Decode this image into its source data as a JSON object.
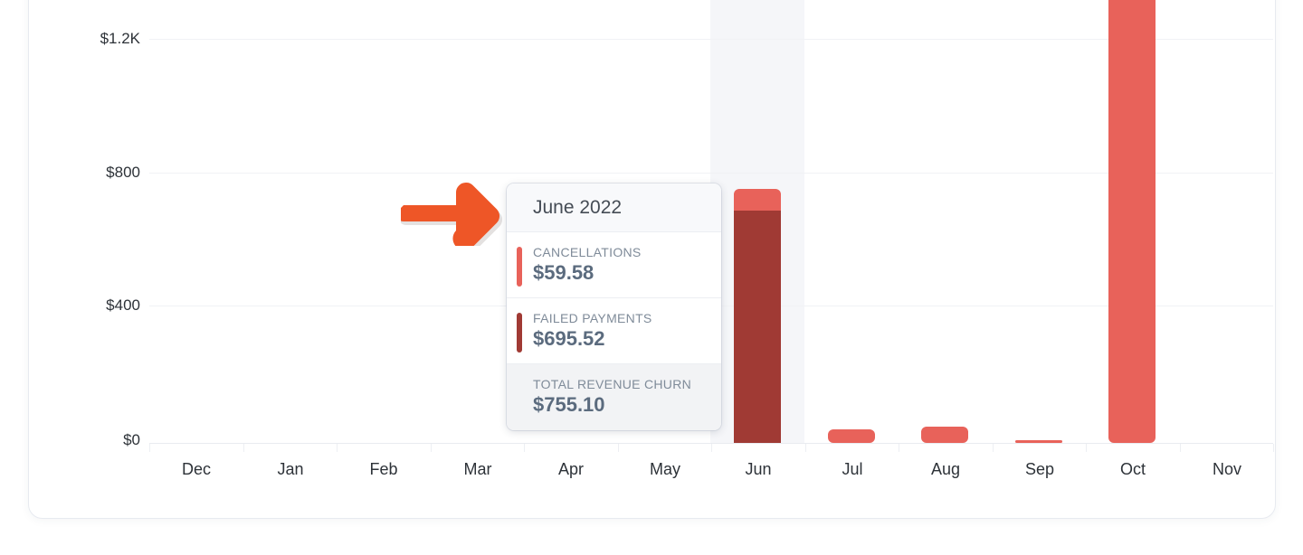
{
  "colors": {
    "cancellations": "#e8625a",
    "failed_payments": "#a03a34",
    "arrow": "#ee5627",
    "gridline": "#f1f2f5",
    "highlight_column": "#f5f6f9",
    "text_primary": "#2d3238",
    "text_value": "#5b6b7e",
    "text_label": "#7f8b99",
    "card_border": "#e7eaf0"
  },
  "tooltip": {
    "title": "June 2022",
    "rows": [
      {
        "label": "CANCELLATIONS",
        "value": "$59.58",
        "color": "#e8625a"
      },
      {
        "label": "FAILED PAYMENTS",
        "value": "$695.52",
        "color": "#a03a34"
      }
    ],
    "total": {
      "label": "TOTAL REVENUE CHURN",
      "value": "$755.10"
    }
  },
  "annotation": {
    "icon": "arrow-right-icon",
    "points_to": "June 2022"
  },
  "chart_data": {
    "type": "bar",
    "stacked": true,
    "title": "",
    "xlabel": "",
    "ylabel": "",
    "ylim": [
      0,
      1334
    ],
    "yticks": [
      0,
      400,
      800,
      1200
    ],
    "ytick_labels": [
      "$0",
      "$400",
      "$800",
      "$1.2K"
    ],
    "grid": true,
    "legend": "none",
    "highlighted_category": "Jun",
    "categories": [
      "Dec",
      "Jan",
      "Feb",
      "Mar",
      "Apr",
      "May",
      "Jun",
      "Jul",
      "Aug",
      "Sep",
      "Oct",
      "Nov"
    ],
    "series": [
      {
        "name": "Cancellations",
        "color": "#e8625a",
        "values": [
          0,
          0,
          0,
          0,
          0,
          0,
          59.58,
          40,
          47,
          6,
          1335,
          0
        ]
      },
      {
        "name": "Failed Payments",
        "color": "#a03a34",
        "values": [
          0,
          0,
          0,
          0,
          0,
          0,
          695.52,
          0,
          0,
          0,
          0,
          0
        ]
      }
    ],
    "totals": [
      0,
      0,
      0,
      0,
      0,
      0,
      755.1,
      40,
      47,
      6,
      1335,
      0
    ]
  }
}
